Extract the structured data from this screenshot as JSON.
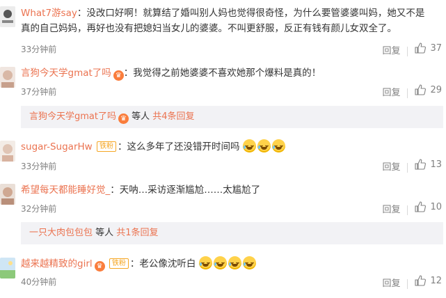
{
  "comments": [
    {
      "user": "What7游say",
      "text": "：没改口好啊！就算结了婚叫别人妈也觉得很奇怪，为什么要管婆婆叫妈，她又不是",
      "text2": "真的自己妈妈，再好也没有把媳妇当女儿的婆婆。不叫更舒服，反正有钱有颜儿女双全了。",
      "time": "33分钟前",
      "reply": "回复",
      "likes": "37"
    },
    {
      "user": "言狗今天学gmat了吗",
      "text": "：我觉得之前她婆婆不喜欢她那个爆料是真的！",
      "time": "37分钟前",
      "reply": "回复",
      "likes": "29",
      "subreply": {
        "user": "言狗今天学gmat了吗",
        "mid": " 等人 ",
        "more": "共4条回复"
      }
    },
    {
      "user": "sugar-SugarHw",
      "badge": "铁粉",
      "text": "：这么多年了还没错开时间吗",
      "time": "33分钟前",
      "reply": "回复",
      "likes": "13"
    },
    {
      "user": "希望每天都能睡好觉_",
      "text": "：天呐…采访逐渐尴尬……太尴尬了",
      "time": "32分钟前",
      "reply": "回复",
      "likes": "10",
      "subreply": {
        "user": "一只大肉包包包",
        "mid": " 等人 ",
        "more": "共1条回复"
      }
    },
    {
      "user": "越来越精致的girl",
      "badge": "铁粉",
      "text": "：老公像沈听白",
      "time": "40分钟前",
      "reply": "回复",
      "likes": "12"
    }
  ],
  "colors": {
    "username": "#eb7350",
    "meta": "#808080",
    "subreply_bg": "#f2f2f5"
  },
  "icons": [
    "thumb-up-icon",
    "vip-icon",
    "laugh-cry-emoji"
  ]
}
